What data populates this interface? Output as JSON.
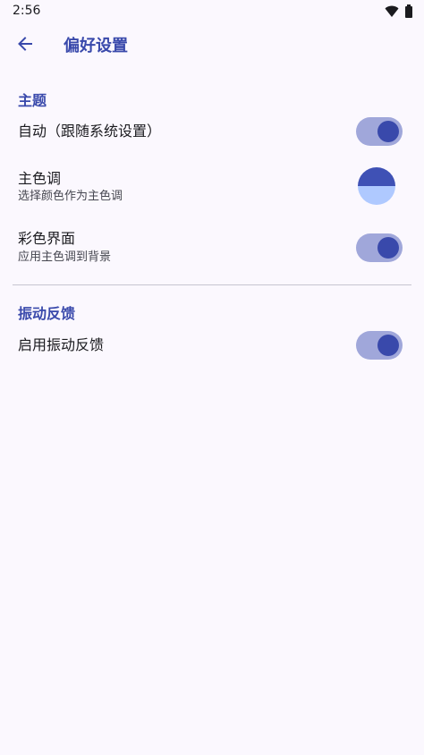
{
  "status_bar": {
    "time": "2:56",
    "icons": [
      "wifi-icon",
      "battery-icon"
    ]
  },
  "app_bar": {
    "back_icon": "arrow-back-icon",
    "title": "偏好设置"
  },
  "colors": {
    "accent": "#3949AB",
    "switch_track_on": "#A0A7DA",
    "primary_swatch_top": "#3F51B5",
    "primary_swatch_bottom": "#AFC9FF",
    "background": "#FBF8FE"
  },
  "sections": [
    {
      "header": "主题",
      "items": [
        {
          "title": "自动（跟随系统设置）",
          "summary": "",
          "control": "switch",
          "checked": true
        },
        {
          "title": "主色调",
          "summary": "选择颜色作为主色调",
          "control": "color-swatch"
        },
        {
          "title": "彩色界面",
          "summary": "应用主色调到背景",
          "control": "switch",
          "checked": true
        }
      ]
    },
    {
      "header": "振动反馈",
      "items": [
        {
          "title": "启用振动反馈",
          "summary": "",
          "control": "switch",
          "checked": true
        }
      ]
    }
  ]
}
